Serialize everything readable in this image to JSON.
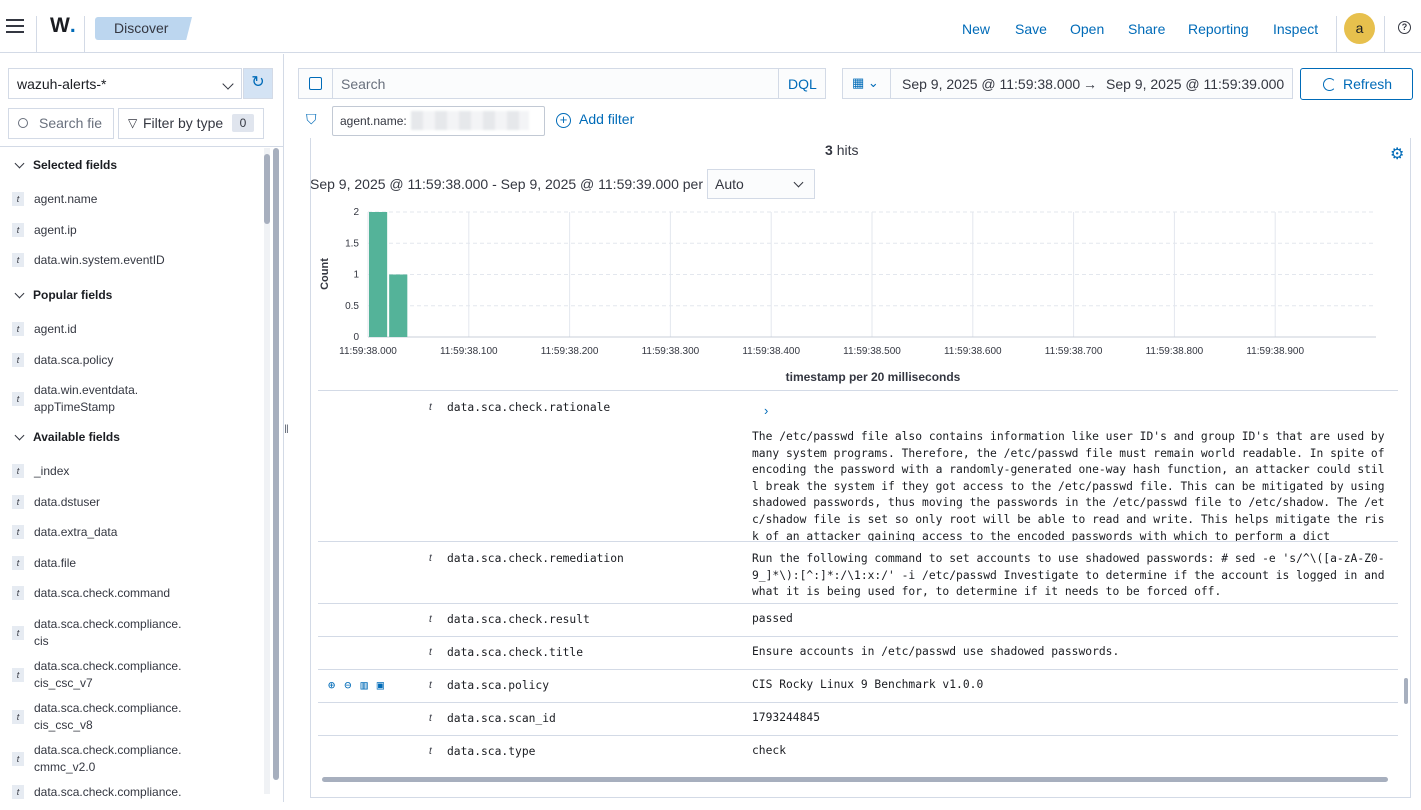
{
  "header": {
    "logo": "W",
    "breadcrumb": "Discover",
    "links": [
      "New",
      "Save",
      "Open",
      "Share",
      "Reporting",
      "Inspect"
    ],
    "avatar": "a",
    "help": "?"
  },
  "sidebar": {
    "index_pattern": "wazuh-alerts-*",
    "search_placeholder": "Search field names",
    "search_visible": "Search fie",
    "filter_by_type": "Filter by type",
    "filter_count": "0",
    "sections": {
      "selected": "Selected fields",
      "popular": "Popular fields",
      "available": "Available fields"
    },
    "selected_fields": [
      "agent.name",
      "agent.ip",
      "data.win.system.eventID"
    ],
    "popular_fields": [
      "agent.id",
      "data.sca.policy",
      "data.win.eventdata.\nappTimeStamp"
    ],
    "available_fields": [
      "_index",
      "data.dstuser",
      "data.extra_data",
      "data.file",
      "data.sca.check.command",
      "data.sca.check.compliance.\ncis",
      "data.sca.check.compliance.\ncis_csc_v7",
      "data.sca.check.compliance.\ncis_csc_v8",
      "data.sca.check.compliance.\ncmmc_v2.0",
      "data.sca.check.compliance."
    ],
    "field_type": "t"
  },
  "query": {
    "placeholder": "Search",
    "language": "DQL",
    "date_from": "Sep 9, 2025 @ 11:59:38.000",
    "arrow": "→",
    "date_to": "Sep 9, 2025 @ 11:59:39.000",
    "refresh": "Refresh",
    "filter_pill": "agent.name:",
    "add_filter": "Add filter"
  },
  "histogram": {
    "hits_count": "3",
    "hits_label": "hits",
    "interval_text": "Sep 9, 2025 @ 11:59:38.000 - Sep 9, 2025 @ 11:59:39.000 per",
    "interval_value": "Auto"
  },
  "chart_data": {
    "type": "bar",
    "x": [
      "11:59:38.000",
      "11:59:38.020"
    ],
    "values": [
      2,
      1
    ],
    "x_ticks": [
      "11:59:38.000",
      "11:59:38.100",
      "11:59:38.200",
      "11:59:38.300",
      "11:59:38.400",
      "11:59:38.500",
      "11:59:38.600",
      "11:59:38.700",
      "11:59:38.800",
      "11:59:38.900"
    ],
    "y_ticks": [
      "0",
      "0.5",
      "1",
      "1.5",
      "2"
    ],
    "ylim": [
      0,
      2
    ],
    "xlabel": "timestamp per 20 milliseconds",
    "ylabel": "Count",
    "grid": true,
    "bar_color": "#54b399"
  },
  "document_rows": [
    {
      "type": "t",
      "key": "data.sca.check.rationale",
      "value": "The /etc/passwd file also contains information like user ID's and group ID's that are used by many system programs. Therefore, the /etc/passwd file must remain world readable. In spite of encoding the password with a randomly-generated one-way hash function, an attacker could still break the system if they got access to the /etc/passwd file. This can be mitigated by using shadowed passwords, thus moving the passwords in the /etc/passwd file to /etc/shadow. The /etc/shadow file is set so only root will be able to read and write. This helps mitigate the risk of an attacker gaining access to the encoded passwords with which to perform a dict"
    },
    {
      "type": "t",
      "key": "data.sca.check.remediation",
      "value": "Run the following command to set accounts to use shadowed passwords: # sed -e 's/^\\([a-zA-Z0-9_]*\\):[^:]*:/\\1:x:/' -i /etc/passwd Investigate to determine if the account is logged in and what it is being used for, to determine if it needs to be forced off."
    },
    {
      "type": "t",
      "key": "data.sca.check.result",
      "value": "passed"
    },
    {
      "type": "t",
      "key": "data.sca.check.title",
      "value": "Ensure accounts in /etc/passwd use shadowed passwords."
    },
    {
      "type": "t",
      "key": "data.sca.policy",
      "value": "CIS Rocky Linux 9 Benchmark v1.0.0"
    },
    {
      "type": "t",
      "key": "data.sca.scan_id",
      "value": "1793244845"
    },
    {
      "type": "t",
      "key": "data.sca.type",
      "value": "check"
    }
  ]
}
